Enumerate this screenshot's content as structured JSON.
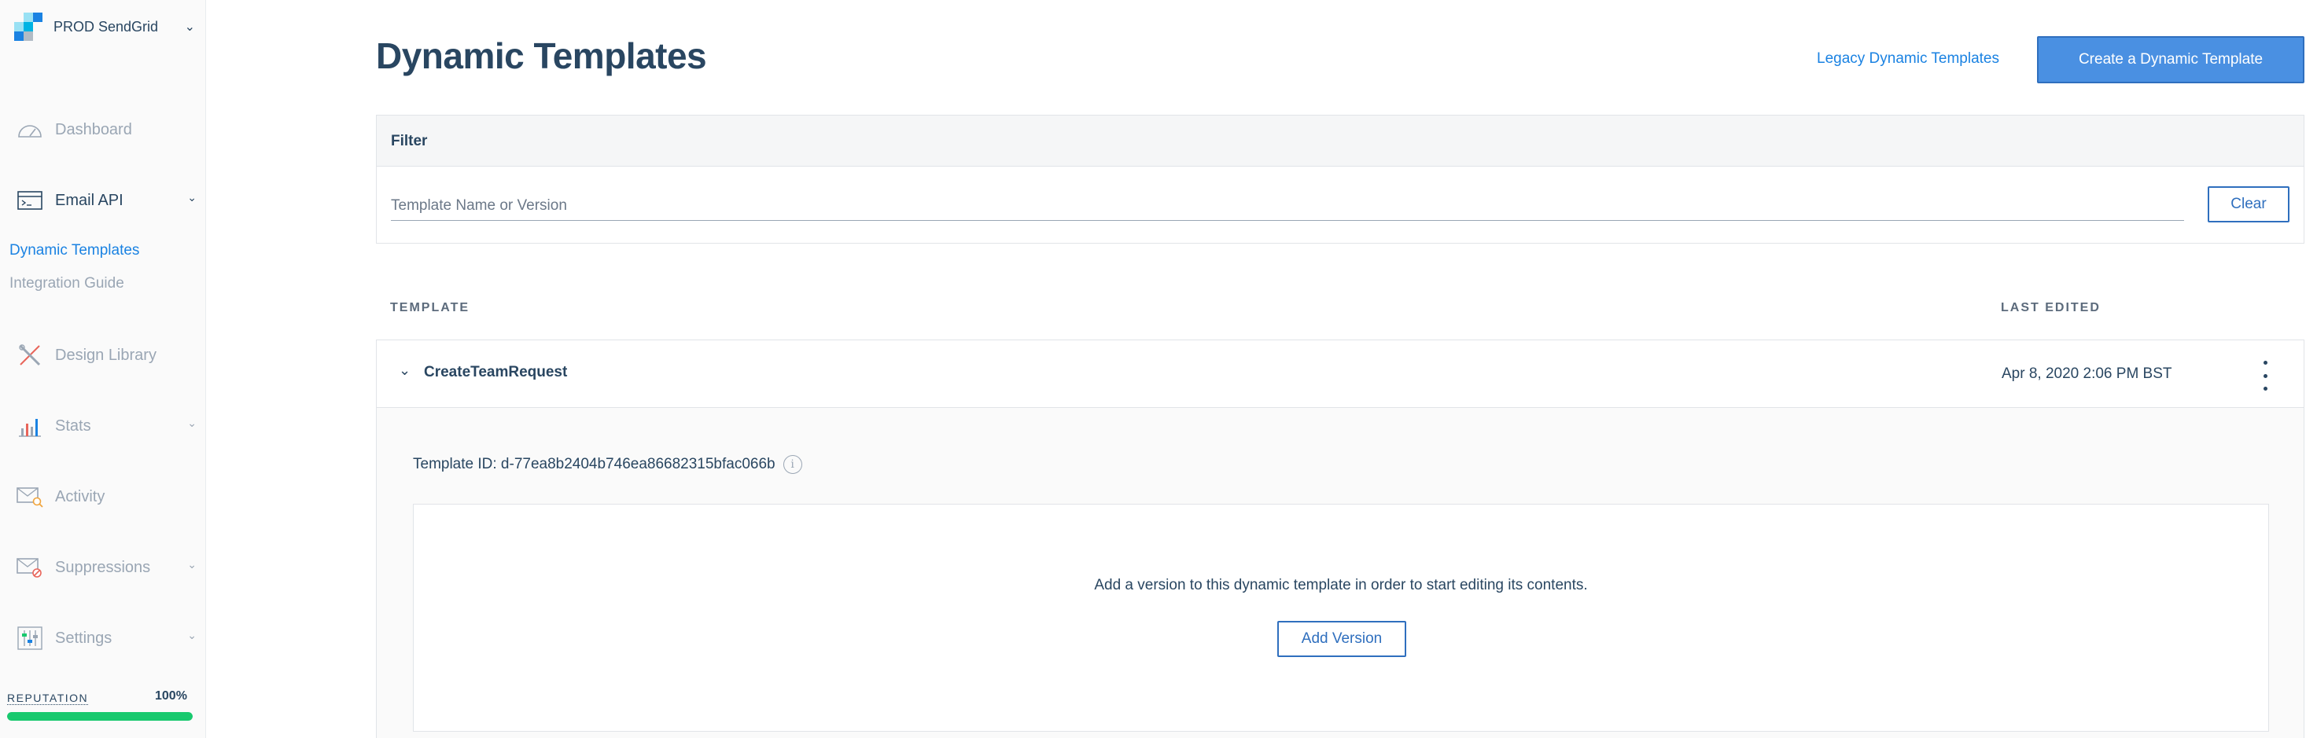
{
  "account": {
    "name": "PROD SendGrid",
    "logo_colors": [
      "#99e1f4",
      "#1a82e2",
      "#00b3e3",
      "#294661"
    ]
  },
  "sidebar": {
    "items": [
      {
        "label": "Dashboard",
        "icon": "gauge-icon"
      },
      {
        "label": "Email API",
        "icon": "terminal-window-icon",
        "expanded": true
      },
      {
        "label": "Design Library",
        "icon": "pencil-ruler-icon"
      },
      {
        "label": "Stats",
        "icon": "bar-chart-icon"
      },
      {
        "label": "Activity",
        "icon": "envelope-search-icon"
      },
      {
        "label": "Suppressions",
        "icon": "envelope-blocked-icon"
      },
      {
        "label": "Settings",
        "icon": "sliders-icon"
      }
    ],
    "email_api_subitems": [
      {
        "label": "Dynamic Templates",
        "current": true
      },
      {
        "label": "Integration Guide",
        "current": false
      }
    ],
    "reputation": {
      "label": "REPUTATION",
      "value_text": "100%",
      "fraction": 1.0
    }
  },
  "header": {
    "title": "Dynamic Templates",
    "legacy_link": "Legacy Dynamic Templates",
    "create_button": "Create a Dynamic Template"
  },
  "filter": {
    "heading": "Filter",
    "placeholder": "Template Name or Version",
    "value": "",
    "clear_button": "Clear"
  },
  "table": {
    "columns": [
      "TEMPLATE",
      "LAST EDITED"
    ],
    "rows": [
      {
        "name": "CreateTeamRequest",
        "last_edited": "Apr 8, 2020 2:06 PM BST",
        "template_id": "Template ID: d-77ea8b2404b746ea86682315bfac066b",
        "empty_message": "Add a version to this dynamic template in order to start editing its contents.",
        "add_version_button": "Add Version"
      }
    ]
  },
  "colors": {
    "accent": "#1a82e2",
    "primary_button": "#4a90e2",
    "text": "#294661",
    "muted": "#9aa6b4",
    "reputation_bar": "#18c96e"
  }
}
